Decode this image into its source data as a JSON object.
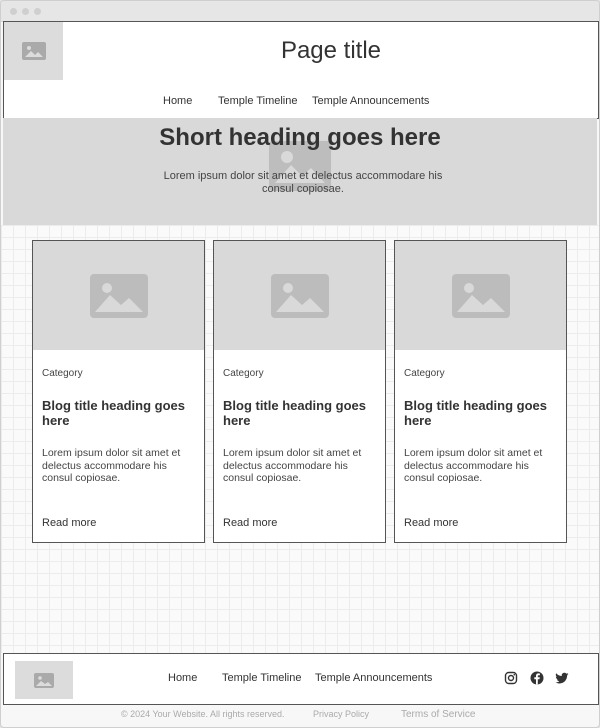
{
  "header": {
    "title": "Page title"
  },
  "nav": {
    "items": [
      "Home",
      "Temple Timeline",
      "Temple Announcements"
    ]
  },
  "hero": {
    "heading": "Short heading goes here",
    "text": "Lorem ipsum dolor sit amet et delectus accommodare his consul copiosae."
  },
  "cards": [
    {
      "category": "Category",
      "title": "Blog title heading goes here",
      "excerpt": "Lorem ipsum dolor sit amet et delectus accommodare his consul copiosae.",
      "link": "Read more"
    },
    {
      "category": "Category",
      "title": "Blog title heading goes here",
      "excerpt": "Lorem ipsum dolor sit amet et delectus accommodare his consul copiosae.",
      "link": "Read more"
    },
    {
      "category": "Category",
      "title": "Blog title heading goes here",
      "excerpt": "Lorem ipsum dolor sit amet et delectus accommodare his consul copiosae.",
      "link": "Read more"
    }
  ],
  "footer": {
    "nav": [
      "Home",
      "Temple Timeline",
      "Temple Announcements"
    ],
    "social_icons": [
      "instagram-icon",
      "facebook-icon",
      "twitter-icon"
    ],
    "copyright": "© 2024 Your Website. All rights reserved.",
    "privacy": "Privacy Policy",
    "terms": "Terms of Service"
  },
  "colors": {
    "placeholder": "#d9d9d9",
    "border": "#555555",
    "text": "#333333"
  }
}
